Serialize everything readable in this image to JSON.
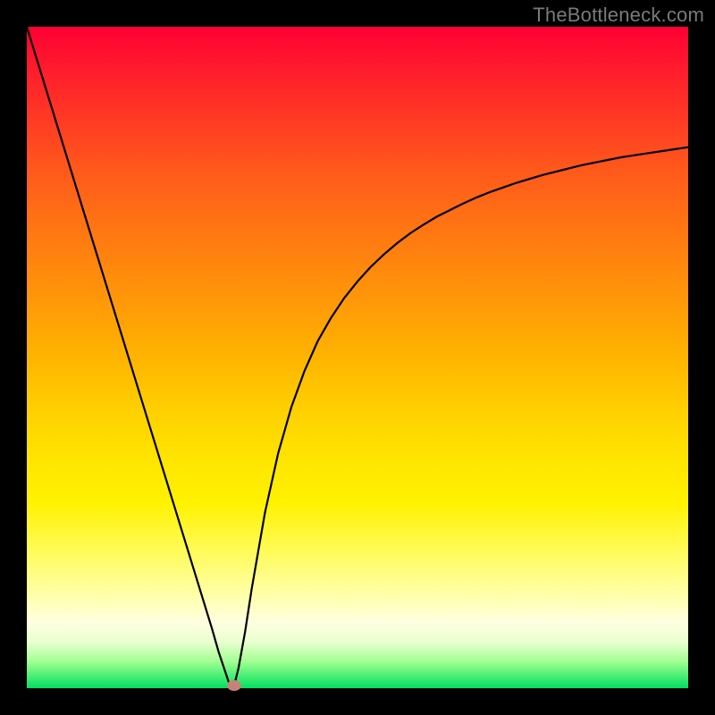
{
  "watermark": {
    "text": "TheBottleneck.com"
  },
  "chart_data": {
    "type": "line",
    "title": "",
    "xlabel": "",
    "ylabel": "",
    "xlim": [
      0,
      1
    ],
    "ylim": [
      0,
      1
    ],
    "x": [
      0.0,
      0.02,
      0.04,
      0.06,
      0.08,
      0.1,
      0.12,
      0.14,
      0.16,
      0.18,
      0.2,
      0.22,
      0.24,
      0.26,
      0.28,
      0.29,
      0.3,
      0.305,
      0.31,
      0.315,
      0.32,
      0.33,
      0.34,
      0.36,
      0.38,
      0.4,
      0.42,
      0.44,
      0.46,
      0.48,
      0.5,
      0.52,
      0.54,
      0.56,
      0.58,
      0.6,
      0.62,
      0.64,
      0.66,
      0.68,
      0.7,
      0.72,
      0.74,
      0.76,
      0.78,
      0.8,
      0.82,
      0.84,
      0.86,
      0.88,
      0.9,
      0.92,
      0.94,
      0.96,
      0.98,
      1.0
    ],
    "y": [
      1.0,
      0.935,
      0.87,
      0.805,
      0.74,
      0.675,
      0.61,
      0.545,
      0.48,
      0.415,
      0.35,
      0.285,
      0.22,
      0.155,
      0.09,
      0.055,
      0.025,
      0.01,
      0.0,
      0.01,
      0.03,
      0.085,
      0.15,
      0.265,
      0.355,
      0.425,
      0.48,
      0.525,
      0.56,
      0.59,
      0.615,
      0.637,
      0.656,
      0.673,
      0.688,
      0.701,
      0.713,
      0.723,
      0.733,
      0.742,
      0.75,
      0.757,
      0.764,
      0.77,
      0.776,
      0.781,
      0.786,
      0.791,
      0.795,
      0.799,
      0.803,
      0.806,
      0.809,
      0.812,
      0.815,
      0.818
    ],
    "marker": {
      "x": 0.313,
      "y": 0.004,
      "color": "#c78278"
    },
    "background_gradient": {
      "direction": "top-to-bottom",
      "stops": [
        {
          "pos": 0.0,
          "color": "#ff0033"
        },
        {
          "pos": 0.5,
          "color": "#ffb400"
        },
        {
          "pos": 0.86,
          "color": "#ffffaa"
        },
        {
          "pos": 1.0,
          "color": "#00e060"
        }
      ]
    }
  }
}
